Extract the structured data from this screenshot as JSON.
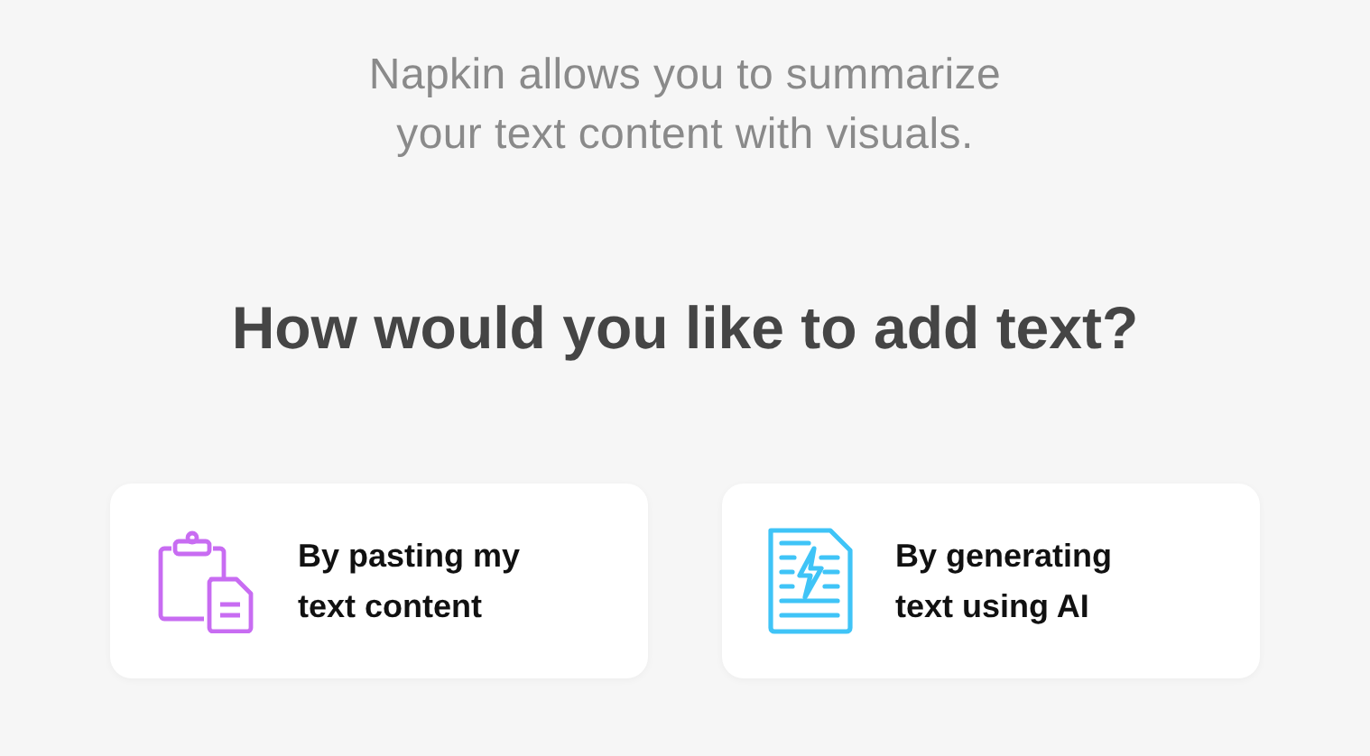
{
  "intro": {
    "lines": [
      "Napkin allows you to summarize",
      "your text content with visuals."
    ]
  },
  "heading": "How would you like to add text?",
  "options": [
    {
      "kind": "paste",
      "lines": [
        "By pasting my",
        "text content"
      ]
    },
    {
      "kind": "generate",
      "lines": [
        "By generating",
        "text using AI"
      ]
    }
  ]
}
